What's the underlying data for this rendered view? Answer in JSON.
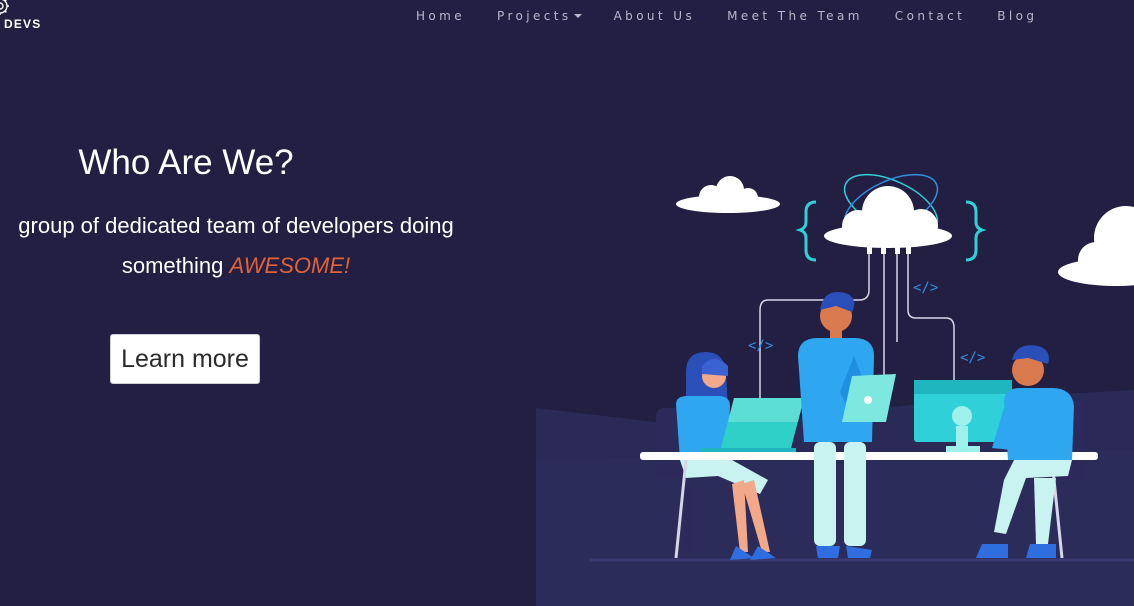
{
  "brand": {
    "name_fragment": "A DEVS"
  },
  "nav": {
    "items": [
      {
        "label": "Home"
      },
      {
        "label": "Projects",
        "has_dropdown": true
      },
      {
        "label": "About Us"
      },
      {
        "label": "Meet The Team"
      },
      {
        "label": "Contact"
      },
      {
        "label": "Blog"
      }
    ]
  },
  "hero": {
    "title": "Who Are We?",
    "subtitle_line1": "group of dedicated team of developers doing",
    "subtitle_line2_prefix": "something ",
    "subtitle_highlight": "AWESOME!",
    "cta_label": "Learn more"
  },
  "illustration": {
    "code_tag": "</>"
  },
  "colors": {
    "background": "#231f42",
    "highlight": "#e0623a",
    "nav_text": "#b9b7cc",
    "accent_cyan": "#2fd0d8",
    "accent_blue": "#2f8fe0"
  }
}
